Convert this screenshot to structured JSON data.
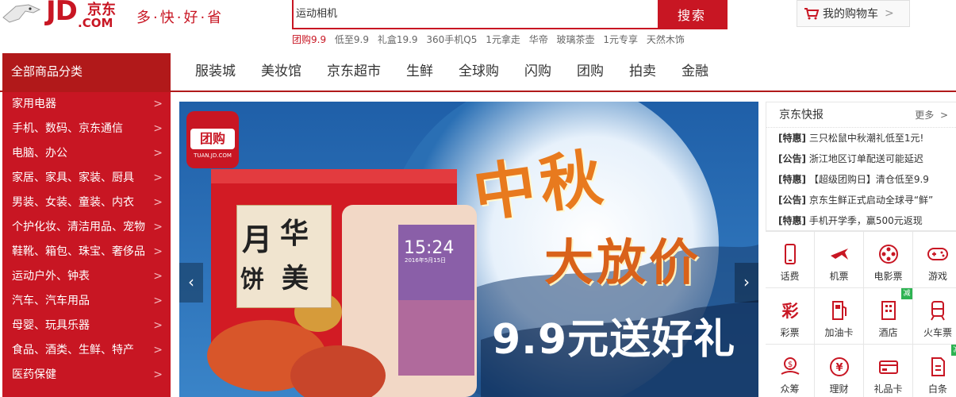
{
  "header": {
    "logo_text": "JD",
    "logo_cn": "京东",
    "logo_domain": ".COM",
    "slogan": "多·快·好·省"
  },
  "search": {
    "value": "运动相机",
    "button_label": "搜索",
    "hotwords": [
      "团购9.9",
      "低至9.9",
      "礼盒19.9",
      "360手机Q5",
      "1元拿走",
      "华帝",
      "玻璃茶壶",
      "1元专享",
      "天然木饰"
    ]
  },
  "cart": {
    "label": "我的购物车"
  },
  "nav": {
    "all_categories": "全部商品分类",
    "links": [
      "服装城",
      "美妆馆",
      "京东超市",
      "生鲜",
      "全球购",
      "闪购",
      "团购",
      "拍卖",
      "金融"
    ]
  },
  "categories": [
    "家用电器",
    "手机、数码、京东通信",
    "电脑、办公",
    "家居、家具、家装、厨具",
    "男装、女装、童装、内衣",
    "个护化妆、清洁用品、宠物",
    "鞋靴、箱包、珠宝、奢侈品",
    "运动户外、钟表",
    "汽车、汽车用品",
    "母婴、玩具乐器",
    "食品、酒类、生鲜、特产",
    "医药保健"
  ],
  "banner": {
    "badge": "团购",
    "badge_url": "TUAN.JD.COM",
    "title_line1": "中秋",
    "title_line2": "大放价",
    "subtitle": "9.9元送好礼",
    "mooncake_chars": [
      "月",
      "华",
      "饼",
      "美"
    ],
    "phone_time": "15:24",
    "phone_date": "2016年5月15日",
    "prev": "‹",
    "next": "›"
  },
  "news": {
    "title": "京东快报",
    "more": "更多",
    "items": [
      {
        "tag": "[特惠]",
        "text": "三只松鼠中秋潮礼低至1元!"
      },
      {
        "tag": "[公告]",
        "text": "浙江地区订单配送可能延迟"
      },
      {
        "tag": "[特惠]",
        "text": "【超级团购日】清仓低至9.9"
      },
      {
        "tag": "[公告]",
        "text": "京东生鲜正式启动全球寻“鲜”"
      },
      {
        "tag": "[特惠]",
        "text": "手机开学季，赢500元返现"
      }
    ]
  },
  "services": [
    {
      "label": "话费",
      "icon": "phone-icon"
    },
    {
      "label": "机票",
      "icon": "plane-icon"
    },
    {
      "label": "电影票",
      "icon": "film-icon"
    },
    {
      "label": "游戏",
      "icon": "gamepad-icon"
    },
    {
      "label": "彩票",
      "icon": "lottery-icon"
    },
    {
      "label": "加油卡",
      "icon": "fuel-icon"
    },
    {
      "label": "酒店",
      "icon": "hotel-icon",
      "flag": "减"
    },
    {
      "label": "火车票",
      "icon": "train-icon"
    },
    {
      "label": "众筹",
      "icon": "crowdfund-icon"
    },
    {
      "label": "理财",
      "icon": "finance-icon"
    },
    {
      "label": "礼品卡",
      "icon": "giftcard-icon"
    },
    {
      "label": "白条",
      "icon": "credit-icon",
      "flag": "减"
    }
  ],
  "colors": {
    "brand_red": "#c81623",
    "nav_red": "#b1191a",
    "banner_blue": "#3a7fc4",
    "promo_orange": "#e87a1e"
  }
}
